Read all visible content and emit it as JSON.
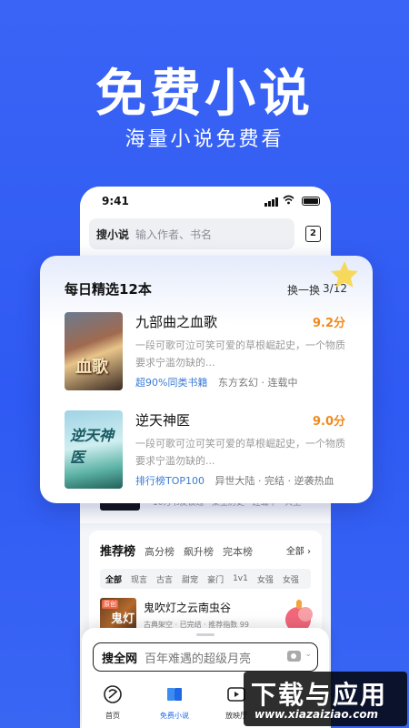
{
  "hero": {
    "title": "免费小说",
    "subtitle": "海量小说免费看"
  },
  "phone": {
    "status_time": "9:41",
    "search_label": "搜小说",
    "search_placeholder": "输入作者、书名",
    "count_badge": "2",
    "hidden_row_text": "10万书友锁过 · 架空历史 · 连载中 · 兵王",
    "rank": {
      "tabs": [
        "推荐榜",
        "高分榜",
        "飙升榜",
        "完本榜"
      ],
      "all_label": "全部 ›",
      "genres": [
        "全部",
        "现言",
        "古言",
        "甜宠",
        "豪门",
        "1v1",
        "女强",
        "女强"
      ],
      "book": {
        "cover_tag": "原创",
        "cover_text": "鬼灯",
        "name": "鬼吹灯之云南虫谷",
        "meta": "古典架空 · 已完结 · 推荐指数 99"
      }
    }
  },
  "daily": {
    "title": "每日精选12本",
    "swap": "换一换",
    "page": "3/12",
    "books": [
      {
        "name": "九部曲之血歌",
        "score": "9.2分",
        "desc": "一段可歌可泣可笑可爱的草根崛起史，一个物质要求宁滥勿缺的...",
        "tag_blue": "超90%同类书籍",
        "tag_grey": "东方玄幻 · 连载中",
        "cover_text": "血歌"
      },
      {
        "name": "逆天神医",
        "score": "9.0分",
        "desc": "一段可歌可泣可笑可爱的草根崛起史，一个物质要求宁滥勿缺的...",
        "tag_blue": "排行榜TOP100",
        "tag_grey": "异世大陆 · 完结 · 逆袭热血",
        "cover_text": "逆天神医"
      }
    ]
  },
  "bottom": {
    "search_label": "搜全网",
    "search_placeholder": "百年难遇的超级月亮",
    "nav": [
      {
        "label": "首页",
        "icon": "home-icon"
      },
      {
        "label": "免费小说",
        "icon": "book-icon"
      },
      {
        "label": "放映厅",
        "icon": "play-icon"
      },
      {
        "label": "",
        "icon": ""
      }
    ]
  },
  "watermark": {
    "line1": "下载与应用",
    "line2": "www.xiazaiziao.com"
  },
  "colors": {
    "background": "#2f5af3",
    "accent_blue": "#1f68e6",
    "score_orange": "#f08a1c",
    "tag_blue": "#3a7bd5"
  }
}
